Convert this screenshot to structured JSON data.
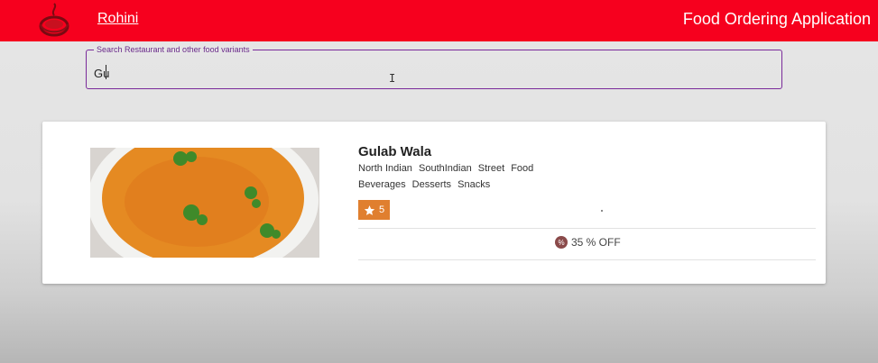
{
  "header": {
    "user_link": "Rohini",
    "app_title": "Food Ordering Application",
    "bar_color": "#f6001e",
    "logo_icon": "food-plate-logo-icon"
  },
  "search": {
    "label": "Search Restaurant and other food variants",
    "value": "Gu",
    "border_color": "#7a2a9a"
  },
  "restaurant": {
    "name": "Gulab Wala",
    "cuisines": [
      "North Indian",
      "SouthIndian",
      "Street",
      "Food",
      "Beverages",
      "Desserts",
      "Snacks"
    ],
    "rating": "5",
    "rating_color": "#e07f2f",
    "offer_text": "35 % OFF",
    "image_icon": "dal-bowl-image"
  }
}
